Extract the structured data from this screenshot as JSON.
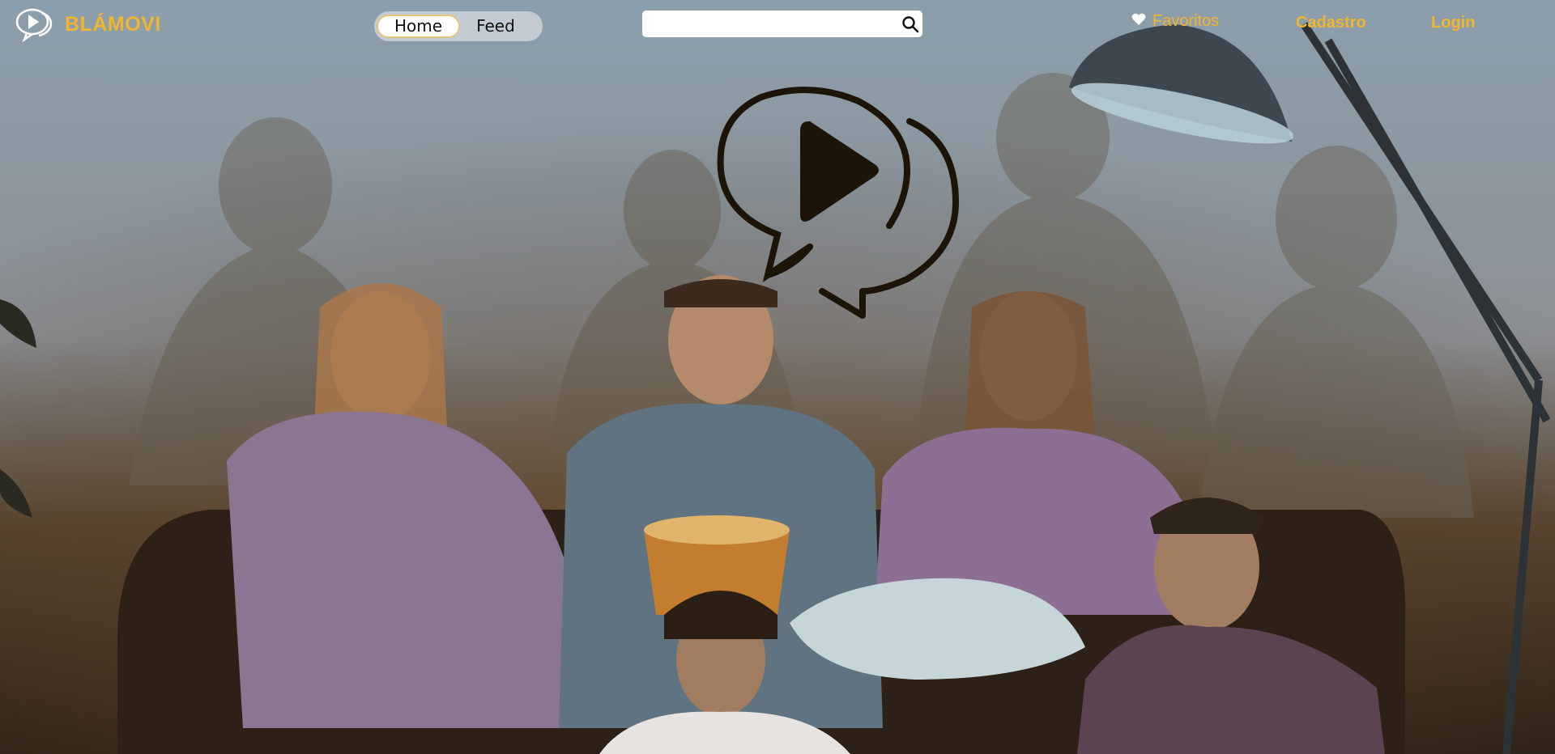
{
  "brand": {
    "name": "BLÁMOVI",
    "logo_icon": "play-speech-bubble-icon"
  },
  "nav_toggle": {
    "items": [
      {
        "label": "Home",
        "active": true
      },
      {
        "label": "Feed",
        "active": false
      }
    ]
  },
  "search": {
    "value": "",
    "icon": "search-icon"
  },
  "nav": {
    "favoritos": {
      "label": "Favoritos",
      "icon": "heart-icon"
    },
    "cadastro": "Cadastro",
    "login": "Login"
  },
  "hero": {
    "logo_icon": "play-speech-bubble-icon"
  },
  "colors": {
    "accent": "#f2b531",
    "logo_dark": "#1d1408",
    "toggle_bg": "#cdd4da"
  }
}
